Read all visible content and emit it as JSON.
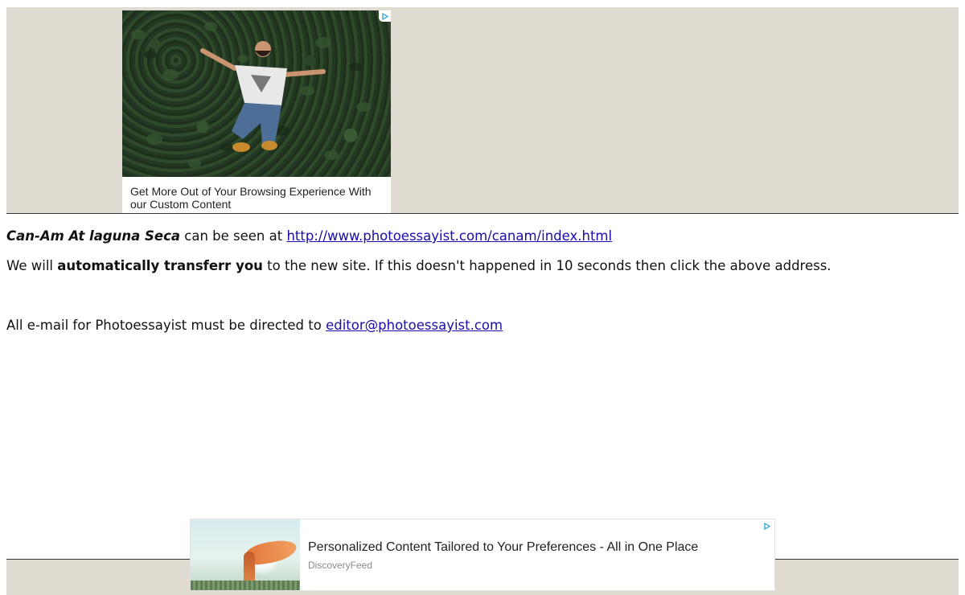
{
  "colors": {
    "band_background": "#dfdbd0",
    "link": "#1a0dab",
    "adchoices": "#2aa6d6"
  },
  "top_ad": {
    "icon": "adchoices-icon",
    "image": "man-jumping-in-front-of-ivy-wall",
    "caption": "Get More Out of Your Browsing Experience With our Custom Content"
  },
  "content": {
    "line1": {
      "title": "Can-Am At laguna Seca",
      "middle": " can be seen at ",
      "link": "http://www.photoessayist.com/canam/index.html"
    },
    "line2": {
      "before": "We will ",
      "bold": "automatically transferr you",
      "after": " to the new site. If this doesn't happened in 10 seconds then click the above address."
    },
    "line3": {
      "before": "All e-mail for Photoessayist must be directed to ",
      "email": "editor@photoessayist.com"
    }
  },
  "bottom_ad": {
    "icon": "adchoices-icon",
    "image": "woman-with-orange-scarf-in-field",
    "title": "Personalized Content Tailored to Your Preferences - All in One Place",
    "source": "DiscoveryFeed"
  }
}
